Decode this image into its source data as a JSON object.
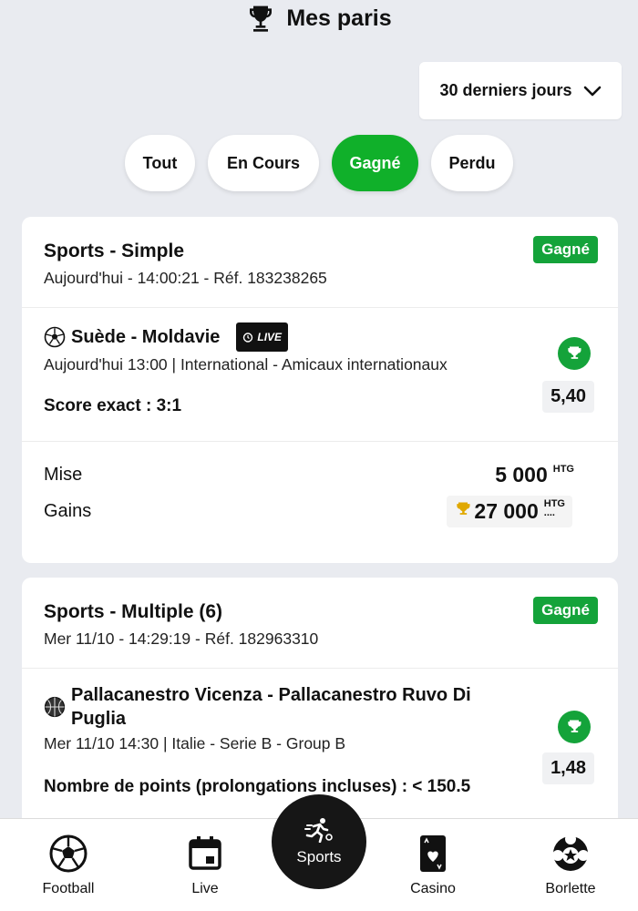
{
  "header": {
    "title": "Mes paris",
    "icon": "trophy-icon"
  },
  "filter": {
    "period": "30 derniers jours",
    "icon": "chevron-down-icon"
  },
  "tabs": [
    {
      "label": "Tout",
      "active": false
    },
    {
      "label": "En Cours",
      "active": false
    },
    {
      "label": "Gagné",
      "active": true
    },
    {
      "label": "Perdu",
      "active": false
    }
  ],
  "bets": [
    {
      "title": "Sports - Simple",
      "meta": "Aujourd'hui - 14:00:21 - Réf. 183238265",
      "status": "Gagné",
      "selection": {
        "icon": "soccer-ball-icon",
        "name": "Suède - Moldavie",
        "live_label": "LIVE",
        "meta": "Aujourd'hui 13:00 | International  -  Amicaux internationaux",
        "bet": "Score exact : 3:1",
        "odds": "5,40"
      },
      "stake_label": "Mise",
      "stake_value": "5 000",
      "gains_label": "Gains",
      "gains_value": "27 000",
      "currency": "HTG",
      "gains_dots": "...."
    },
    {
      "title": "Sports - Multiple (6)",
      "meta": "Mer 11/10 - 14:29:19 - Réf. 182963310",
      "status": "Gagné",
      "selection": {
        "icon": "basketball-icon",
        "name_line1": "Pallacanestro Vicenza - Pallacanestro Ruvo Di",
        "name_line2": "Puglia",
        "meta": "Mer 11/10 14:30 | Italie  -  Serie B  -  Group B",
        "bet": "Nombre de points (prolongations incluses) : < 150.5",
        "odds": "1,48"
      }
    }
  ],
  "nav": {
    "football": "Football",
    "live": "Live",
    "sports": "Sports",
    "casino": "Casino",
    "borlette": "Borlette"
  },
  "colors": {
    "accent": "#10b02a",
    "status_green": "#14a33a",
    "background": "#e9ebf0"
  }
}
